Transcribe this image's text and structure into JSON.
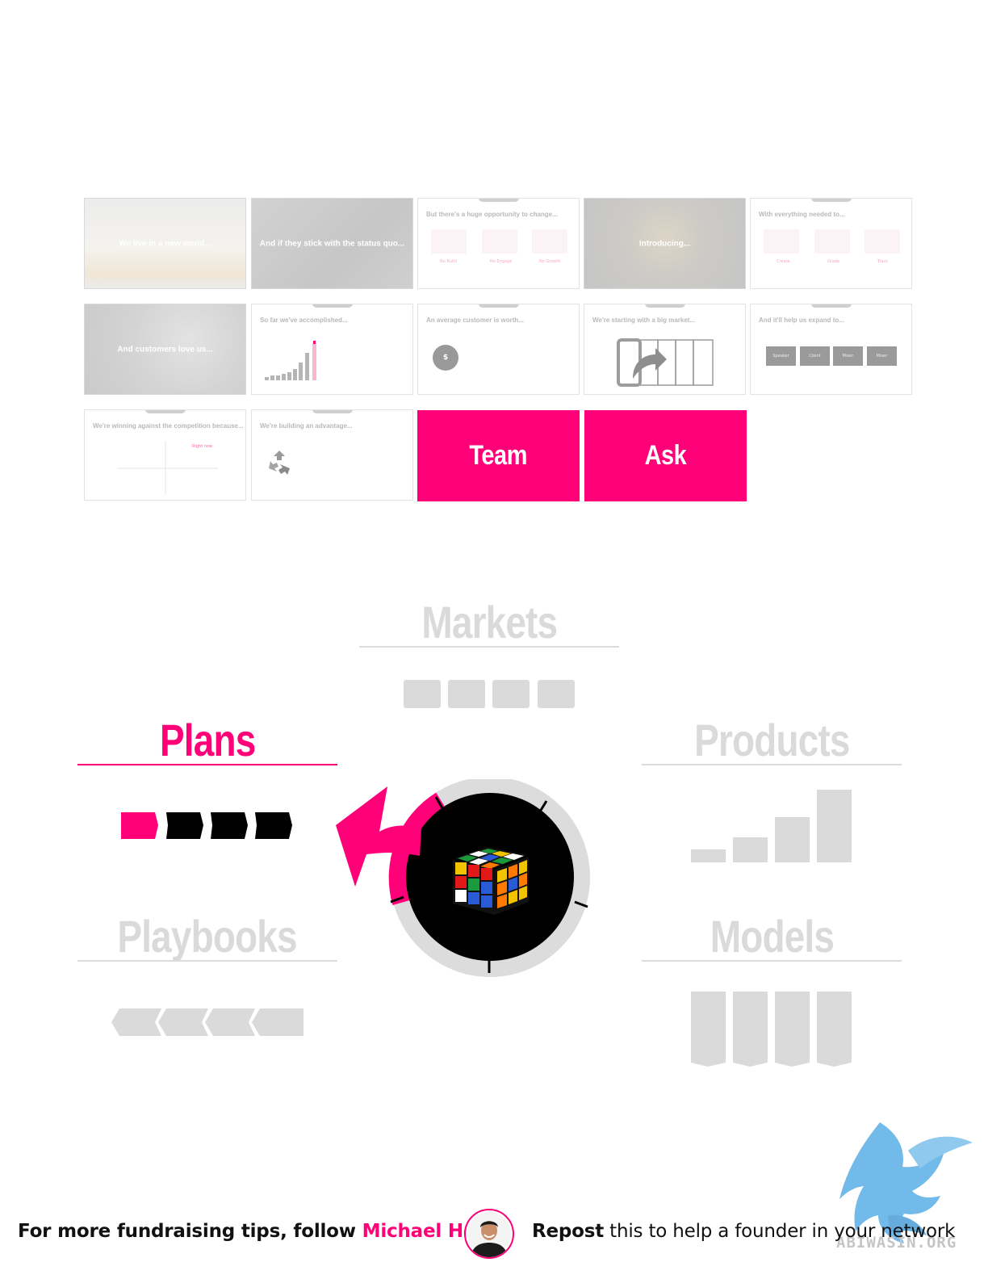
{
  "slides": [
    {
      "text": "We live in a new world..."
    },
    {
      "text": "And if they stick with the status quo..."
    },
    {
      "text": "But there's a huge opportunity to change...",
      "labels": [
        "No Build",
        "No Engage",
        "No Growth"
      ]
    },
    {
      "text": "Introducing..."
    },
    {
      "text": "With everything needed to...",
      "labels": [
        "Create",
        "Grade",
        "Track"
      ]
    },
    {
      "text": "And customers love us..."
    },
    {
      "text": "So far we've accomplished..."
    },
    {
      "text": "An average customer is worth...",
      "badge": "$"
    },
    {
      "text": "We're starting with a big market..."
    },
    {
      "text": "And it'll help us expand to...",
      "buttons": [
        "Speaker",
        "Client",
        "Mixer",
        "Mixer"
      ]
    },
    {
      "text": "We're winning against the competition because...",
      "label": "Right now"
    },
    {
      "text": "We're building an advantage..."
    },
    {
      "text": "Team"
    },
    {
      "text": "Ask"
    }
  ],
  "framework": {
    "markets": "Markets",
    "plans": "Plans",
    "products": "Products",
    "playbooks": "Playbooks",
    "models": "Models"
  },
  "footer": {
    "left_prefix": "For more fundraising tips, follow ",
    "author": "Michael Ho",
    "right_bold": "Repost",
    "right_rest": " this to help a founder in your network",
    "watermark": "ABIWASIN.ORG"
  },
  "colors": {
    "accent": "#ff0078",
    "muted": "#dadada",
    "dark": "#000000"
  },
  "icons": [
    "rubiks-cube-icon",
    "pink-arrow-icon",
    "recycle-icon",
    "phone-share-icon",
    "eagle-watermark-icon"
  ]
}
